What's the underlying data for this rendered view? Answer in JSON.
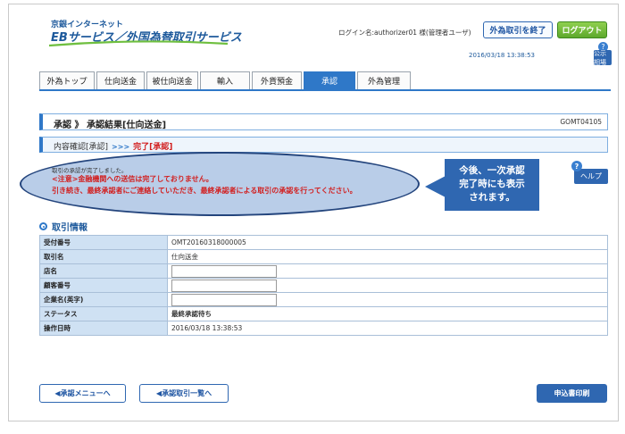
{
  "brand": {
    "line1": "京銀インターネット",
    "line2": "EBサービス／外国為替取引サービス"
  },
  "header": {
    "login_info": "ログイン名:authorizer01 様(管理者ユーザ)",
    "end_fx_button": "外為取引を終了",
    "logout_button": "ログアウト",
    "datetime": "2016/03/18 13:38:53",
    "help_mark": "?",
    "rate_button": "公示相場"
  },
  "tabs": [
    {
      "label": "外為トップ"
    },
    {
      "label": "仕向送金"
    },
    {
      "label": "被仕向送金"
    },
    {
      "label": "輸入"
    },
    {
      "label": "外貨預金"
    },
    {
      "label": "承認",
      "active": true
    },
    {
      "label": "外為管理"
    }
  ],
  "page": {
    "title": "承認 》 承認結果[仕向送金]",
    "screen_id": "GOMT04105",
    "step_done": "内容確認[承認]",
    "step_arrow": ">>>",
    "step_current": "完了[承認]"
  },
  "messages": {
    "line1": "取引の承認が完了しました。",
    "line2": "<注意>金融機関への送信は完了しておりません。",
    "line3": "引き続き、最終承認者にご連絡していただき、最終承認者による取引の承認を行ってください。"
  },
  "callout": {
    "line1": "今後、一次承認",
    "line2": "完了時にも表示",
    "line3": "されます。"
  },
  "help": {
    "mark": "?",
    "label": "ヘルプ"
  },
  "section": {
    "title": "取引情報"
  },
  "info_table": [
    {
      "label": "受付番号",
      "value": "OMT20160318000005"
    },
    {
      "label": "取引名",
      "value": "仕向送金"
    },
    {
      "label": "店名",
      "value": ""
    },
    {
      "label": "顧客番号",
      "value": ""
    },
    {
      "label": "企業名(英字)",
      "value": ""
    },
    {
      "label": "ステータス",
      "value": "最終承認待ち"
    },
    {
      "label": "操作日時",
      "value": "2016/03/18 13:38:53"
    }
  ],
  "buttons": {
    "approval_menu": "◀承認メニューへ",
    "approval_list": "◀承認取引一覧へ",
    "print": "申込書印刷"
  }
}
